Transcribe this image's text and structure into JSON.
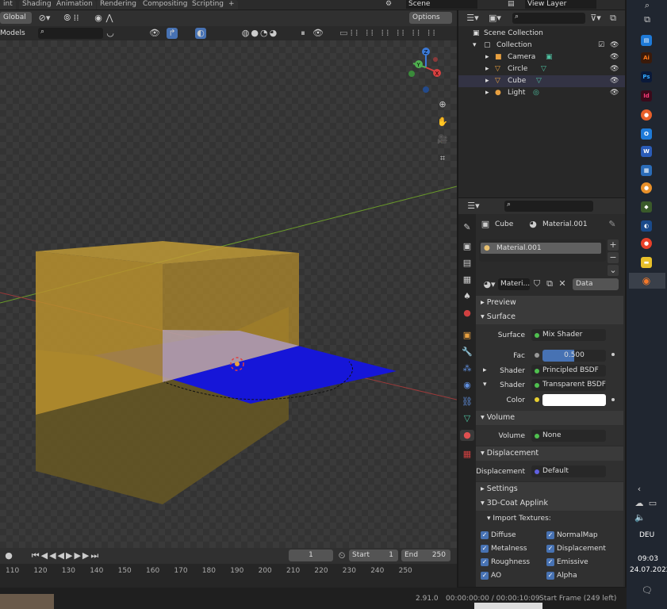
{
  "workspace_tabs": [
    "int",
    "Shading",
    "Animation",
    "Rendering",
    "Compositing",
    "Scripting",
    "+"
  ],
  "scene": {
    "name": "Scene",
    "view_layer": "View Layer"
  },
  "header": {
    "orientation": "Global",
    "options": "Options"
  },
  "header2": {
    "select": "Models"
  },
  "outliner": {
    "title": "Scene Collection",
    "collection": "Collection",
    "items": [
      "Camera",
      "Circle",
      "Cube",
      "Light"
    ]
  },
  "properties": {
    "object": "Cube",
    "material": "Material.001",
    "slot": "Material.001",
    "mat_short": "Materi...",
    "link": "Data",
    "panels": {
      "preview": "Preview",
      "surface": "Surface",
      "volume": "Volume",
      "displacement": "Displacement",
      "settings": "Settings",
      "coat": "3D-Coat Applink",
      "import": "Import Textures:"
    },
    "surface": {
      "surface_label": "Surface",
      "surface_val": "Mix Shader",
      "fac_label": "Fac",
      "fac_val": "0.500",
      "fac_fraction": 0.5,
      "shader1_label": "Shader",
      "shader1_val": "Principled BSDF",
      "shader2_label": "Shader",
      "shader2_val": "Transparent BSDF",
      "color_label": "Color"
    },
    "volume": {
      "label": "Volume",
      "val": "None"
    },
    "displacement": {
      "label": "Displacement",
      "val": "Default"
    },
    "textures": [
      "Diffuse",
      "NormalMap",
      "Metalness",
      "Displacement",
      "Roughness",
      "Emissive",
      "AO",
      "Alpha"
    ]
  },
  "timeline": {
    "current": "1",
    "start_label": "Start",
    "start": "1",
    "end_label": "End",
    "end": "250"
  },
  "ruler": [
    "110",
    "120",
    "130",
    "140",
    "150",
    "160",
    "170",
    "180",
    "190",
    "200",
    "210",
    "220",
    "230",
    "240",
    "250"
  ],
  "status": {
    "version": "2.91.0",
    "time": "00:00:00:00 / 00:00:10:09",
    "frame": "Start Frame (249 left)"
  },
  "taskbar": {
    "lang": "DEU",
    "time": "09:03",
    "date": "24.07.2022"
  },
  "colors": {
    "accent": "#4772b3",
    "cube": "#b8902e",
    "plane": "#2020e0"
  }
}
